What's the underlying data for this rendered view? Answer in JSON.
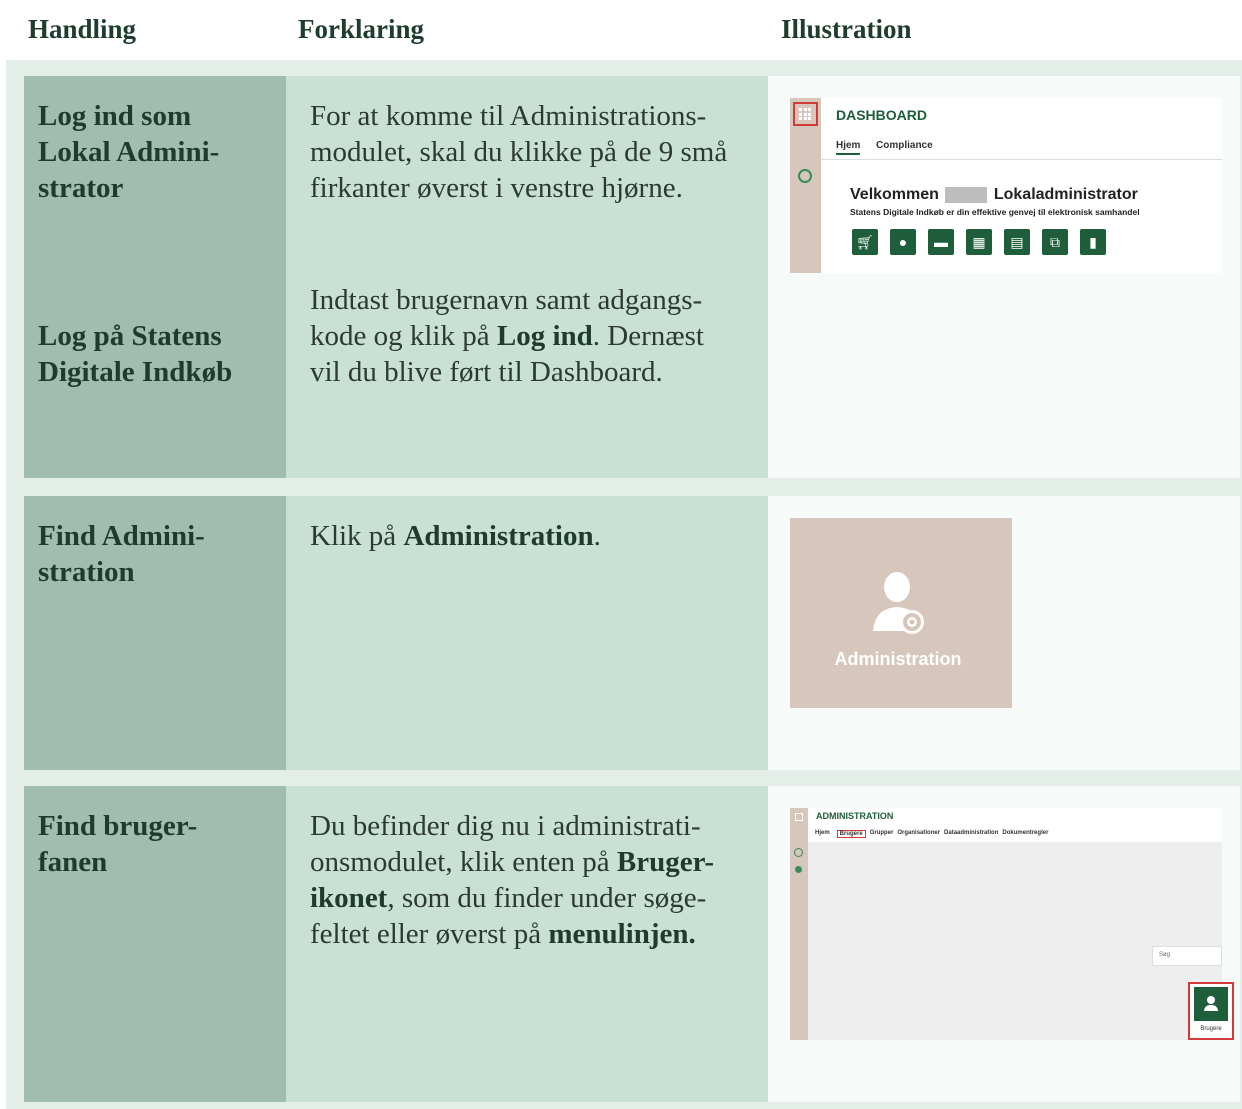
{
  "headers": {
    "handling": "Handling",
    "forklaring": "Forklaring",
    "illustration": "Illustration"
  },
  "rows": [
    {
      "action_1": "Log ind som\nLokal Admini-\nstrator",
      "action_2": "Log på Statens\nDigitale Indkøb",
      "text_1": "For at komme til Administrations-modulet, skal du klikke på de 9 små firkanter øverst i venstre hjørne.",
      "text_2_a": "Indtast brugernavn samt adgangs-kode og klik på ",
      "text_2_b": "Log ind",
      "text_2_c": ". Dernæst vil du blive ført til Dashboard."
    },
    {
      "action": "Find Admini-\nstration",
      "text_a": "Klik på ",
      "text_b": "Administration",
      "text_c": "."
    },
    {
      "action": "Find bruger-\nfanen",
      "text_a": "Du befinder dig nu i administrati-onsmodulet, klik enten på ",
      "text_b": "Bruger-ikonet",
      "text_c": ", som du finder under søge-feltet eller øverst på ",
      "text_d": "menulinjen."
    }
  ],
  "dashboard": {
    "title": "DASHBOARD",
    "tab_hjem": "Hjem",
    "tab_compliance": "Compliance",
    "welcome_a": "Velkommen",
    "welcome_b": "Lokaladministrator",
    "subtitle": "Statens Digitale Indkøb er din effektive genvej til elektronisk samhandel",
    "icons": [
      "cart-icon",
      "user-gear-icon",
      "handshake-icon",
      "excel-icon",
      "report-icon",
      "exchange-icon",
      "document-icon"
    ]
  },
  "admin_tile": {
    "label": "Administration"
  },
  "admin_module": {
    "title": "ADMINISTRATION",
    "tabs": [
      "Hjem",
      "Brugere",
      "Grupper",
      "Organisationer",
      "Dataadministration",
      "Dokumentregler"
    ],
    "search_placeholder": "Søg",
    "user_button": "Brugere"
  },
  "colors": {
    "green": "#1e5e3b",
    "tan": "#d6c6bb",
    "col1": "#a0bdb1",
    "col2": "#c9e0d6",
    "red": "#d23a3a"
  }
}
